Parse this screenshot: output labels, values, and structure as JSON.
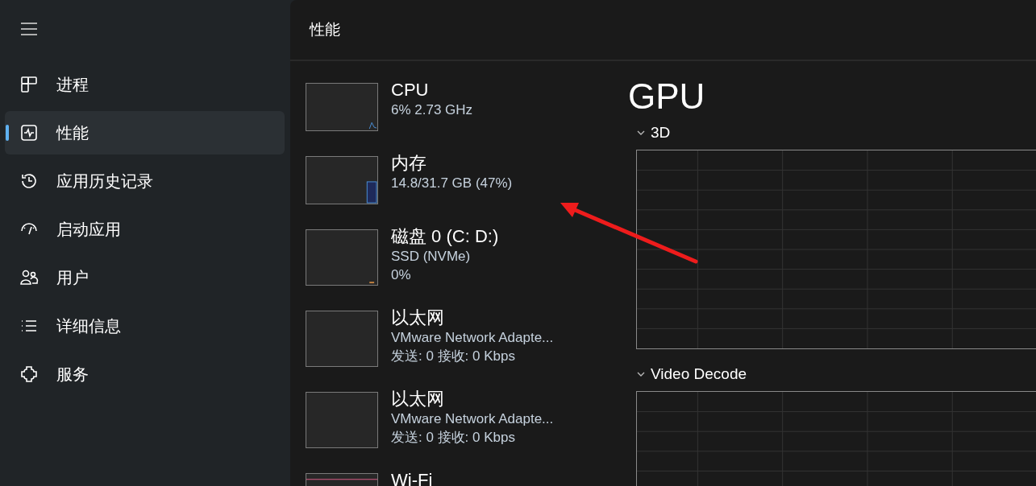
{
  "header": {
    "title": "性能"
  },
  "sidebar": {
    "items": [
      {
        "label": "进程",
        "selected": false
      },
      {
        "label": "性能",
        "selected": true
      },
      {
        "label": "应用历史记录",
        "selected": false
      },
      {
        "label": "启动应用",
        "selected": false
      },
      {
        "label": "用户",
        "selected": false
      },
      {
        "label": "详细信息",
        "selected": false
      },
      {
        "label": "服务",
        "selected": false
      }
    ]
  },
  "devices": [
    {
      "kind": "cpu",
      "title": "CPU",
      "lines": [
        "6%  2.73 GHz"
      ]
    },
    {
      "kind": "memory",
      "title": "内存",
      "lines": [
        "14.8/31.7 GB (47%)"
      ]
    },
    {
      "kind": "disk",
      "title": "磁盘 0 (C: D:)",
      "lines": [
        "SSD (NVMe)",
        "0%"
      ]
    },
    {
      "kind": "network",
      "title": "以太网",
      "lines": [
        "VMware Network Adapte...",
        "发送: 0  接收: 0 Kbps"
      ]
    },
    {
      "kind": "network",
      "title": "以太网",
      "lines": [
        "VMware Network Adapte...",
        "发送: 0  接收: 0 Kbps"
      ]
    },
    {
      "kind": "wifi",
      "title": "Wi-Fi"
    }
  ],
  "detail": {
    "title": "GPU",
    "sections": [
      {
        "label": "3D",
        "expanded": true
      },
      {
        "label": "Video Decode",
        "expanded": true
      }
    ]
  }
}
